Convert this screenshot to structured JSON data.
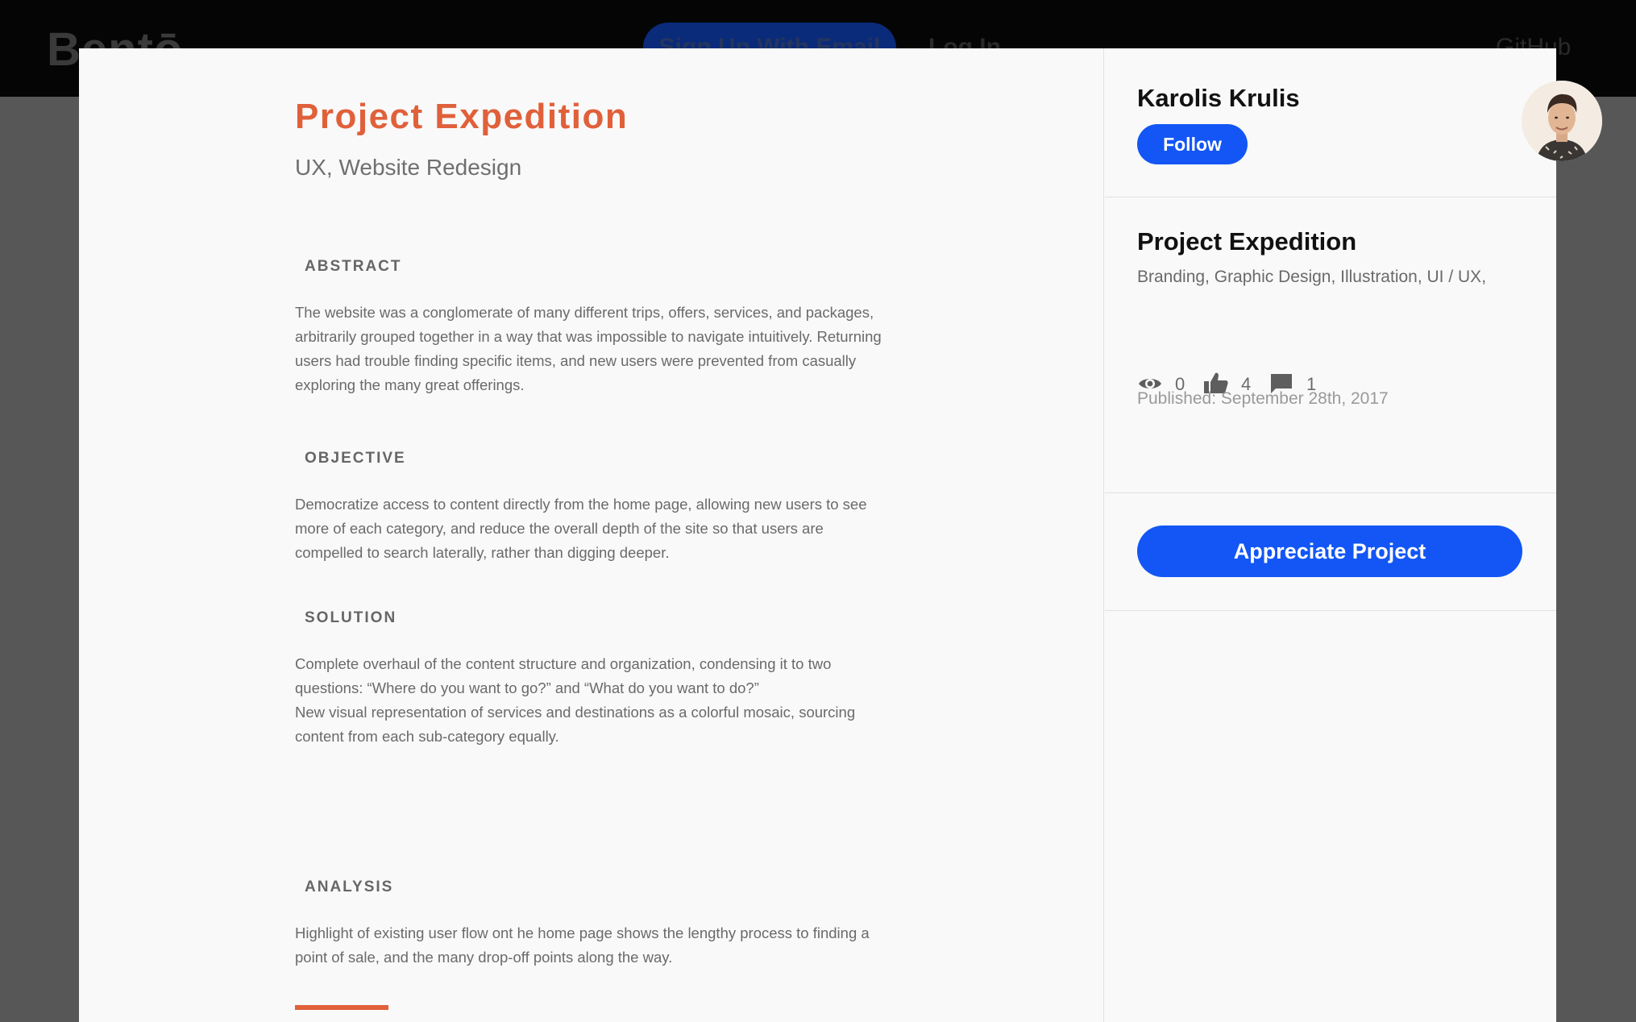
{
  "background_header": {
    "logo": "Bentō",
    "signup_label": "Sign Up With Email",
    "login_label": "Log In",
    "github_label": "GitHub"
  },
  "project": {
    "title": "Project Expedition",
    "subtitle": "UX, Website Redesign",
    "sections": [
      {
        "heading": "ABSTRACT",
        "paragraphs": [
          "The website was a conglomerate of many different trips, offers, services, and packages, arbitrarily grouped together in a way that was impossible to navigate intuitively. Returning users had trouble finding specific items, and new users were prevented from casually exploring the many great offerings."
        ]
      },
      {
        "heading": "OBJECTIVE",
        "paragraphs": [
          "Democratize access to content directly from the home page, allowing new users to see more of each category, and reduce the overall depth of the site so that users are compelled to search laterally, rather than digging deeper."
        ]
      },
      {
        "heading": "SOLUTION",
        "paragraphs": [
          "Complete overhaul of the content structure and organization, condensing it to two questions: “Where do you want to go?” and “What do you want to do?”",
          "New visual representation of services and destinations as a colorful mosaic, sourcing content from each sub-category equally."
        ]
      },
      {
        "heading": "ANALYSIS",
        "paragraphs": [
          "Highlight of existing user flow ont he home page shows the lengthy process to finding a point of sale, and the many drop-off points along the way."
        ]
      }
    ]
  },
  "sidebar": {
    "author_name": "Karolis Krulis",
    "follow_label": "Follow",
    "project_title": "Project Expedition",
    "tags": "Branding, Graphic Design, Illustration, UI / UX,",
    "stats": {
      "views": "0",
      "appreciations": "4",
      "comments": "1"
    },
    "published": "Published: September 28th, 2017",
    "appreciate_label": "Appreciate Project"
  },
  "colors": {
    "accent_orange": "#e0603a",
    "primary_blue": "#1356f5"
  }
}
